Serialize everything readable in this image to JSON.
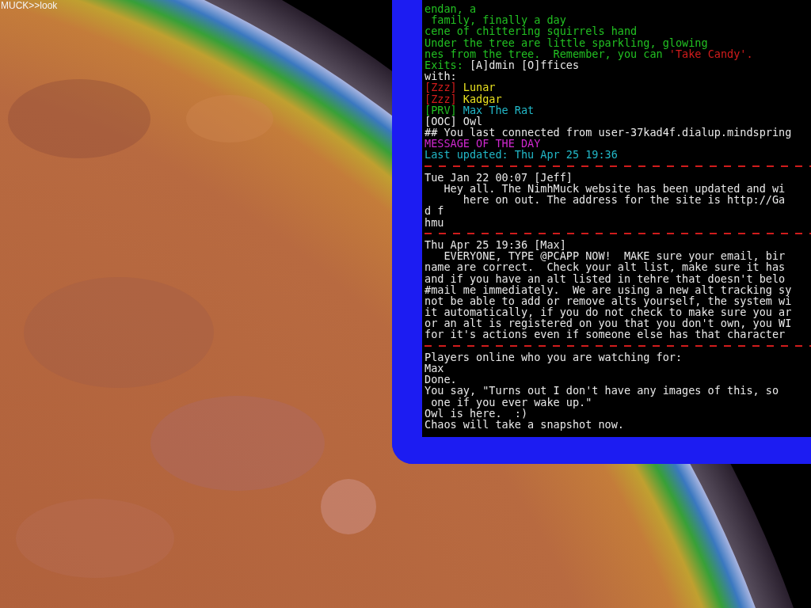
{
  "prompt": {
    "text": "MUCK>>look"
  },
  "terminal": {
    "lines": [
      {
        "kind": "text",
        "segments": [
          {
            "text": "endan, a",
            "color": "#22c022"
          }
        ]
      },
      {
        "kind": "text",
        "segments": [
          {
            "text": " family, finally a day",
            "color": "#22c022"
          }
        ]
      },
      {
        "kind": "text",
        "segments": [
          {
            "text": "cene of chittering squirrels hand",
            "color": "#22c022"
          }
        ]
      },
      {
        "kind": "text",
        "segments": [
          {
            "text": "Under the tree are little sparkling, glowing",
            "color": "#22c022"
          }
        ]
      },
      {
        "kind": "text",
        "segments": [
          {
            "text": "nes from the tree.  Remember, you can ",
            "color": "#22c022"
          },
          {
            "text": "'Take Candy'.",
            "color": "#d41c1c"
          }
        ]
      },
      {
        "kind": "text",
        "segments": [
          {
            "text": "Exits: ",
            "color": "#22c022"
          },
          {
            "text": "[A]dmin [O]ffices",
            "color": "#e8e8e8"
          }
        ]
      },
      {
        "kind": "text",
        "segments": [
          {
            "text": "with:",
            "color": "#e8e8e8"
          }
        ]
      },
      {
        "kind": "text",
        "segments": [
          {
            "text": "[Zzz]",
            "color": "#d41c1c"
          },
          {
            "text": " Lunar",
            "color": "#e8e020"
          }
        ]
      },
      {
        "kind": "text",
        "segments": [
          {
            "text": "[Zzz]",
            "color": "#d41c1c"
          },
          {
            "text": " Kadgar",
            "color": "#e8e020"
          }
        ]
      },
      {
        "kind": "text",
        "segments": [
          {
            "text": "[PRV]",
            "color": "#22c022"
          },
          {
            "text": " Max The Rat",
            "color": "#22b8c8"
          }
        ]
      },
      {
        "kind": "text",
        "segments": [
          {
            "text": "[OOC] Owl",
            "color": "#e8e8e8"
          }
        ]
      },
      {
        "kind": "text",
        "segments": [
          {
            "text": "## You last connected from user-37kad4f.dialup.mindspring",
            "color": "#e8e8e8"
          }
        ]
      },
      {
        "kind": "text",
        "segments": [
          {
            "text": "MESSAGE OF THE DAY",
            "color": "#d028d0"
          }
        ]
      },
      {
        "kind": "text",
        "segments": [
          {
            "text": "Last updated: Thu Apr 25 19:36",
            "color": "#22b8c8"
          }
        ]
      },
      {
        "kind": "rule"
      },
      {
        "kind": "text",
        "segments": [
          {
            "text": "Tue Jan 22 00:07 [Jeff]",
            "color": "#e8e8e8"
          }
        ]
      },
      {
        "kind": "text",
        "segments": [
          {
            "text": "   Hey all. The NimhMuck website has been updated and wi",
            "color": "#e8e8e8"
          }
        ]
      },
      {
        "kind": "text",
        "segments": [
          {
            "text": "      here on out. The address for the site is http://Ga",
            "color": "#e8e8e8"
          }
        ]
      },
      {
        "kind": "text",
        "segments": [
          {
            "text": "d f",
            "color": "#e8e8e8"
          }
        ]
      },
      {
        "kind": "text",
        "segments": [
          {
            "text": "hmu",
            "color": "#e8e8e8"
          }
        ]
      },
      {
        "kind": "rule"
      },
      {
        "kind": "text",
        "segments": [
          {
            "text": "Thu Apr 25 19:36 [Max]",
            "color": "#e8e8e8"
          }
        ]
      },
      {
        "kind": "text",
        "segments": [
          {
            "text": "   EVERYONE, TYPE @PCAPP NOW!  MAKE sure your email, bir",
            "color": "#e8e8e8"
          }
        ]
      },
      {
        "kind": "text",
        "segments": [
          {
            "text": "name are correct.  Check your alt list, make sure it has",
            "color": "#e8e8e8"
          }
        ]
      },
      {
        "kind": "text",
        "segments": [
          {
            "text": "and if you have an alt listed in tehre that doesn't belo",
            "color": "#e8e8e8"
          }
        ]
      },
      {
        "kind": "text",
        "segments": [
          {
            "text": "#mail me immediately.  We are using a new alt tracking sy",
            "color": "#e8e8e8"
          }
        ]
      },
      {
        "kind": "text",
        "segments": [
          {
            "text": "not be able to add or remove alts yourself, the system wi",
            "color": "#e8e8e8"
          }
        ]
      },
      {
        "kind": "text",
        "segments": [
          {
            "text": "it automatically, if you do not check to make sure you ar",
            "color": "#e8e8e8"
          }
        ]
      },
      {
        "kind": "text",
        "segments": [
          {
            "text": "or an alt is registered on you that you don't own, you WI",
            "color": "#e8e8e8"
          }
        ]
      },
      {
        "kind": "text",
        "segments": [
          {
            "text": "for it's actions even if someone else has that character",
            "color": "#e8e8e8"
          }
        ]
      },
      {
        "kind": "rule"
      },
      {
        "kind": "text",
        "segments": [
          {
            "text": "Players online who you are watching for:",
            "color": "#e8e8e8"
          }
        ]
      },
      {
        "kind": "text",
        "segments": [
          {
            "text": "Max",
            "color": "#e8e8e8"
          }
        ]
      },
      {
        "kind": "text",
        "segments": [
          {
            "text": "Done.",
            "color": "#e8e8e8"
          }
        ]
      },
      {
        "kind": "text",
        "segments": [
          {
            "text": "You say, \"Turns out I don't have any images of this, so",
            "color": "#e8e8e8"
          }
        ]
      },
      {
        "kind": "text",
        "segments": [
          {
            "text": " one if you ever wake up.\"",
            "color": "#e8e8e8"
          }
        ]
      },
      {
        "kind": "text",
        "segments": [
          {
            "text": "Owl is here.  :)",
            "color": "#e8e8e8"
          }
        ]
      },
      {
        "kind": "text",
        "segments": [
          {
            "text": "Chaos will take a snapshot now.",
            "color": "#e8e8e8"
          }
        ]
      }
    ]
  }
}
